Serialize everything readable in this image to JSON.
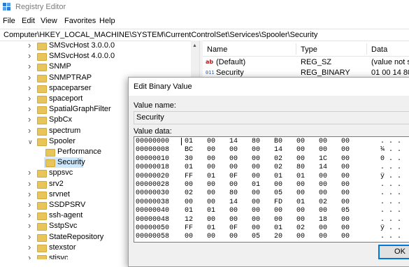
{
  "window": {
    "title": "Registry Editor",
    "icon": "registry-editor-icon"
  },
  "menu": [
    "File",
    "Edit",
    "View",
    "Favorites",
    "Help"
  ],
  "address": "Computer\\HKEY_LOCAL_MACHINE\\SYSTEM\\CurrentControlSet\\Services\\Spooler\\Security",
  "tree": {
    "items": [
      {
        "label": "SMSvcHost 3.0.0.0",
        "level": 1,
        "expandable": true
      },
      {
        "label": "SMSvcHost 4.0.0.0",
        "level": 1,
        "expandable": true
      },
      {
        "label": "SNMP",
        "level": 1,
        "expandable": true
      },
      {
        "label": "SNMPTRAP",
        "level": 1,
        "expandable": true
      },
      {
        "label": "spaceparser",
        "level": 1,
        "expandable": true
      },
      {
        "label": "spaceport",
        "level": 1,
        "expandable": true
      },
      {
        "label": "SpatialGraphFilter",
        "level": 1,
        "expandable": true
      },
      {
        "label": "SpbCx",
        "level": 1,
        "expandable": true
      },
      {
        "label": "spectrum",
        "level": 1,
        "expandable": true
      },
      {
        "label": "Spooler",
        "level": 1,
        "expandable": true,
        "expanded": true
      },
      {
        "label": "Performance",
        "level": 2,
        "expandable": false
      },
      {
        "label": "Security",
        "level": 2,
        "expandable": false,
        "selected": true
      },
      {
        "label": "sppsvc",
        "level": 1,
        "expandable": true
      },
      {
        "label": "srv2",
        "level": 1,
        "expandable": true
      },
      {
        "label": "srvnet",
        "level": 1,
        "expandable": true
      },
      {
        "label": "SSDPSRV",
        "level": 1,
        "expandable": true
      },
      {
        "label": "ssh-agent",
        "level": 1,
        "expandable": true
      },
      {
        "label": "SstpSvc",
        "level": 1,
        "expandable": true
      },
      {
        "label": "StateRepository",
        "level": 1,
        "expandable": true
      },
      {
        "label": "stexstor",
        "level": 1,
        "expandable": true
      },
      {
        "label": "stisvc",
        "level": 1,
        "expandable": true
      }
    ]
  },
  "values_list": {
    "columns": {
      "name": "Name",
      "type": "Type",
      "data": "Data"
    },
    "rows": [
      {
        "icon": "string-value-icon",
        "name": "(Default)",
        "type": "REG_SZ",
        "data": "(value not se"
      },
      {
        "icon": "binary-value-icon",
        "name": "Security",
        "type": "REG_BINARY",
        "data": "01 00 14 80 b"
      }
    ]
  },
  "dialog": {
    "title": "Edit Binary Value",
    "value_name_label": "Value name:",
    "value_name": "Security",
    "value_data_label": "Value data:",
    "hex_rows": [
      {
        "addr": "00000000",
        "bytes": [
          "01",
          "00",
          "14",
          "80",
          "B0",
          "00",
          "00",
          "00"
        ],
        "ascii": ". . ."
      },
      {
        "addr": "00000008",
        "bytes": [
          "BC",
          "00",
          "00",
          "00",
          "14",
          "00",
          "00",
          "00"
        ],
        "ascii": "¼ . ."
      },
      {
        "addr": "00000010",
        "bytes": [
          "30",
          "00",
          "00",
          "00",
          "02",
          "00",
          "1C",
          "00"
        ],
        "ascii": "0 . ."
      },
      {
        "addr": "00000018",
        "bytes": [
          "01",
          "00",
          "00",
          "00",
          "02",
          "80",
          "14",
          "00"
        ],
        "ascii": ". . ."
      },
      {
        "addr": "00000020",
        "bytes": [
          "FF",
          "01",
          "0F",
          "00",
          "01",
          "01",
          "00",
          "00"
        ],
        "ascii": "ÿ . ."
      },
      {
        "addr": "00000028",
        "bytes": [
          "00",
          "00",
          "00",
          "01",
          "00",
          "00",
          "00",
          "00"
        ],
        "ascii": ". . ."
      },
      {
        "addr": "00000030",
        "bytes": [
          "02",
          "00",
          "80",
          "00",
          "05",
          "00",
          "00",
          "00"
        ],
        "ascii": ". . ."
      },
      {
        "addr": "00000038",
        "bytes": [
          "00",
          "00",
          "14",
          "00",
          "FD",
          "01",
          "02",
          "00"
        ],
        "ascii": ". . ."
      },
      {
        "addr": "00000040",
        "bytes": [
          "01",
          "01",
          "00",
          "00",
          "00",
          "00",
          "00",
          "05"
        ],
        "ascii": ". . ."
      },
      {
        "addr": "00000048",
        "bytes": [
          "12",
          "00",
          "00",
          "00",
          "00",
          "00",
          "18",
          "00"
        ],
        "ascii": ". . ."
      },
      {
        "addr": "00000050",
        "bytes": [
          "FF",
          "01",
          "0F",
          "00",
          "01",
          "02",
          "00",
          "00"
        ],
        "ascii": "ÿ . ."
      },
      {
        "addr": "00000058",
        "bytes": [
          "00",
          "00",
          "00",
          "05",
          "20",
          "00",
          "00",
          "00"
        ],
        "ascii": ". . ."
      }
    ],
    "ok_label": "OK"
  }
}
